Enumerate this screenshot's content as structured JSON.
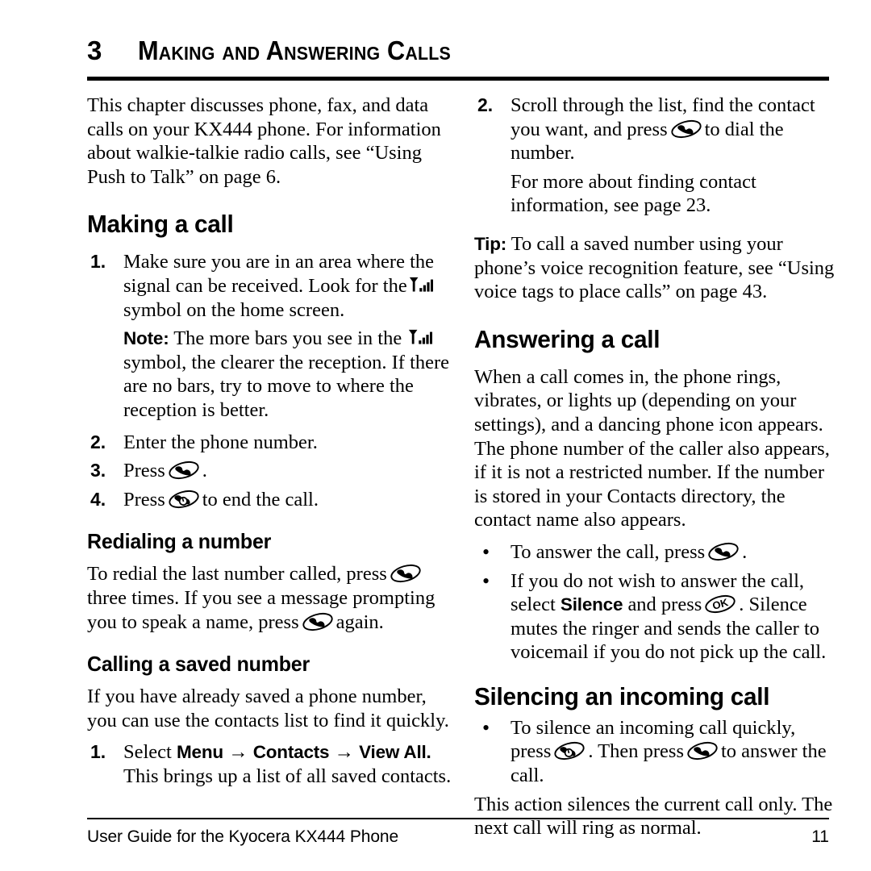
{
  "chapter": {
    "number": "3",
    "title": "Making and Answering Calls"
  },
  "left_column": {
    "intro": "This chapter discusses phone, fax, and data calls on your KX444 phone. For information about walkie-talkie radio calls, see “Using Push to Talk” on page 6.",
    "heading_making_a_call": "Making a call",
    "step1_marker": "1.",
    "step1_part1": "Make sure you are in an area where the signal can be received. Look for the",
    "step1_part2": "symbol on the home screen.",
    "note_label": "Note:",
    "note_part1": "The more bars you see in the",
    "note_part2": "symbol, the clearer the reception. If there are no bars, try to move to where the reception is better.",
    "step2_marker": "2.",
    "step2_text": "Enter the phone number.",
    "step3_marker": "3.",
    "step3_text_before": "Press",
    "step3_text_after": ".",
    "step4_marker": "4.",
    "step4_text_before": "Press",
    "step4_text_after": "to end the call.",
    "heading_redialing": "Redialing a number",
    "redial_part1": "To redial the last number called, press",
    "redial_part2": "three times. If you see a message prompting you to speak a name, press",
    "redial_part3": "again.",
    "heading_calling_saved": "Calling a saved number",
    "calling_saved_intro": "If you have already saved a phone number, you can use the contacts list to find it quickly.",
    "saved_step1_marker": "1.",
    "saved_step1_select": "Select",
    "saved_step1_menu": "Menu",
    "saved_step1_arrow1": "→",
    "saved_step1_contacts": "Contacts",
    "saved_step1_arrow2": "→",
    "saved_step1_viewall": "View All.",
    "saved_step1_tail": "This brings up a list of all saved contacts."
  },
  "right_column": {
    "step2_marker": "2.",
    "step2_part1": "Scroll through the list, find the contact you want, and press",
    "step2_part2": "to dial the number.",
    "step2_sub": "For more about finding contact information, see page 23.",
    "tip_label": "Tip:",
    "tip_text": "To call a saved number using your phone’s voice recognition feature, see “Using voice tags to place calls” on page 43.",
    "heading_answering": "Answering a call",
    "answering_body": "When a call comes in, the phone rings, vibrates, or lights up (depending on your settings), and a dancing phone icon appears. The phone number of the caller also appears, if it is not a restricted number. If the number is stored in your Contacts directory, the contact name also appears.",
    "bullet1_marker": "•",
    "bullet1_before": "To answer the call, press",
    "bullet1_after": ".",
    "bullet2_marker": "•",
    "bullet2_part1": "If you do not wish to answer the call, select",
    "bullet2_silence": "Silence",
    "bullet2_part2": "and press",
    "bullet2_part3": ". Silence mutes the ringer and sends the caller to voicemail if you do not pick up the call.",
    "heading_silencing": "Silencing an incoming call",
    "bullet3_marker": "•",
    "bullet3_part1": "To silence an incoming call quickly, press",
    "bullet3_part2": ". Then press",
    "bullet3_part3": "to answer the call.",
    "silencing_tail": "This action silences the current call only. The next call will ring as normal."
  },
  "footer": {
    "left": "User Guide for the Kyocera KX444 Phone",
    "page_number": "11"
  },
  "icons": {
    "signal": "signal-strength-icon",
    "send_key": "send-call-key-icon",
    "end_key": "end-call-key-icon",
    "ok_key": "ok-key-icon"
  },
  "colors": {
    "text": "#000000",
    "background": "#ffffff"
  }
}
